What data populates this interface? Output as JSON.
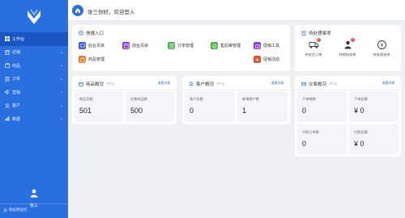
{
  "header": {
    "welcome": "张三你好，欢迎登入"
  },
  "sidebar": {
    "items": [
      {
        "label": "工作台",
        "icon": "dashboard-icon",
        "active": true,
        "has_children": false
      },
      {
        "label": "店铺",
        "icon": "store-icon",
        "has_children": true
      },
      {
        "label": "商品",
        "icon": "goods-icon",
        "has_children": true
      },
      {
        "label": "订单",
        "icon": "order-icon",
        "has_children": true
      },
      {
        "label": "营销",
        "icon": "marketing-icon",
        "has_children": true
      },
      {
        "label": "客户",
        "icon": "customer-icon",
        "has_children": true
      },
      {
        "label": "数据",
        "icon": "data-icon",
        "has_children": true
      }
    ],
    "user_name": "张三",
    "collapse_label": "收起侧边栏"
  },
  "quick_entry": {
    "title": "快捷入口",
    "items": [
      {
        "label": "后台页目",
        "color": "#3a5fe0"
      },
      {
        "label": "前台页目",
        "color": "#8a3fe0"
      },
      {
        "label": "订单管理",
        "color": "#4fb24f"
      },
      {
        "label": "售后审管理",
        "color": "#4fb24f"
      },
      {
        "label": "促销工具",
        "color": "#8a3fe0"
      },
      {
        "label": "商品管理",
        "color": "#f07a2a"
      },
      {
        "label": "促销活动",
        "color": "#e8542a"
      }
    ]
  },
  "todo": {
    "title": "待处理事项",
    "items": [
      {
        "label": "待发货订单",
        "badge": "2"
      },
      {
        "label": "待审核退单",
        "badge": "1"
      },
      {
        "label": "待处理退单",
        "badge": ""
      }
    ]
  },
  "goods_overview": {
    "title": "商品概况",
    "unit": "(今日)",
    "link": "查看详情",
    "stats": [
      {
        "label": "商品总数",
        "value": "501"
      },
      {
        "label": "在售商品数",
        "value": "500"
      }
    ]
  },
  "customer_overview": {
    "title": "客户概况",
    "unit": "(今日)",
    "link": "查看详情",
    "stats": [
      {
        "label": "客户总数",
        "value": "0"
      },
      {
        "label": "新增客户数",
        "value": "1"
      }
    ]
  },
  "trade_overview": {
    "title": "交易概况",
    "unit": "(今日)",
    "link": "查看详情",
    "stats": [
      {
        "label": "下单笔数",
        "value": "0"
      },
      {
        "label": "下单金额",
        "value": "¥ 0"
      },
      {
        "label": "付款订单数",
        "value": "0"
      },
      {
        "label": "付款金额",
        "value": "¥ 0"
      }
    ]
  },
  "colors": {
    "primary": "#2a6fe0",
    "sidebar_active": "#1a55c2",
    "background": "#eef0f4"
  }
}
